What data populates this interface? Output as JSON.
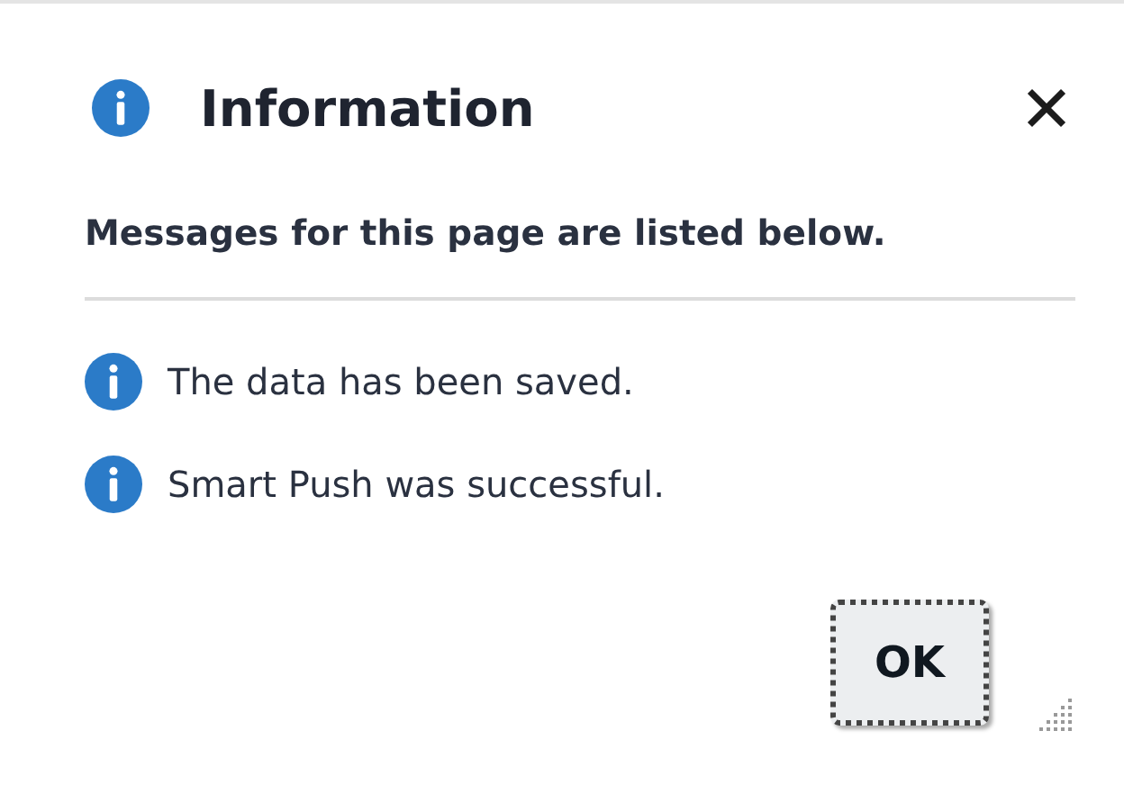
{
  "dialog": {
    "title": "Information",
    "subtitle": "Messages for this page are listed below.",
    "messages": [
      {
        "kind": "info",
        "text": "The data has been saved."
      },
      {
        "kind": "info",
        "text": "Smart Push was successful."
      }
    ],
    "buttons": [
      {
        "label": "OK",
        "focused": true
      }
    ]
  }
}
